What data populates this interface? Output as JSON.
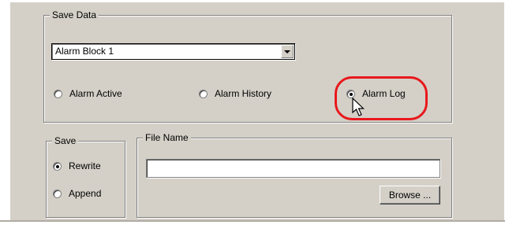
{
  "save_data": {
    "legend": "Save Data",
    "combo_value": "Alarm Block 1",
    "radios": [
      {
        "label": "Alarm Active",
        "checked": false
      },
      {
        "label": "Alarm History",
        "checked": false
      },
      {
        "label": "Alarm Log",
        "checked": true
      }
    ]
  },
  "save": {
    "legend": "Save",
    "radios": [
      {
        "label": "Rewrite",
        "checked": true
      },
      {
        "label": "Append",
        "checked": false
      }
    ]
  },
  "file_name": {
    "legend": "File Name",
    "value": "",
    "browse_label": "Browse ..."
  },
  "colors": {
    "dialog_bg": "#d4d0c8",
    "highlight": "#e8181c"
  },
  "icons": {
    "cursor": "mouse-pointer-icon",
    "dropdown": "chevron-down-icon"
  }
}
